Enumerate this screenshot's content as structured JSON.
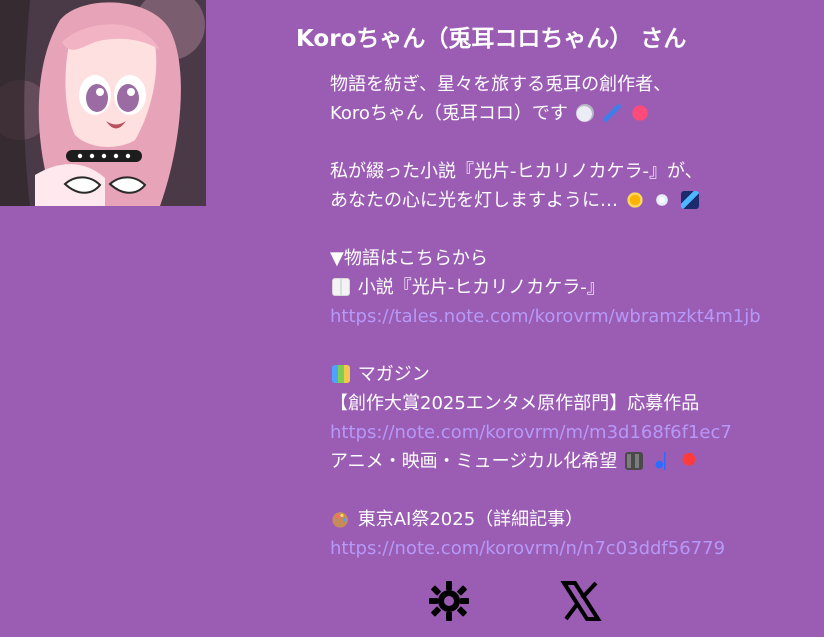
{
  "profile": {
    "title": "Koroちゃん（兎耳コロちゃん） さん",
    "avatar_icon": "anime-girl-avatar"
  },
  "bio": {
    "line1": "物語を紡ぎ、星々を旅する兎耳の創作者、",
    "line2": "Koroちゃん（兎耳コロ）です",
    "line3": "私が綴った小説『光片-ヒカリノカケラ-』が、",
    "line4": "あなたの心に光を灯しますように…",
    "section_story_heading": "▼物語はこちらから",
    "story_label": "小説『光片-ヒカリノカケラ-』",
    "story_link": "https://tales.note.com/korovrm/wbramzkt4m1jb",
    "magazine_label": "マガジン",
    "magazine_award": "【創作大賞2025エンタメ原作部門】応募作品",
    "magazine_link": "https://note.com/korovrm/m/m3d168f6f1ec7",
    "magazine_note": "アニメ・映画・ミュージカル化希望",
    "tokyo_label": "東京AI祭2025（詳細記事）",
    "tokyo_link": "https://note.com/korovrm/n/n7c03ddf56779"
  },
  "icons": {
    "rabbit": "rabbit-icon",
    "pen": "pen-icon",
    "heart": "heart-icon",
    "sun": "sun-icon",
    "snow": "snowflake-icon",
    "comet": "comet-icon",
    "book": "open-book-icon",
    "books": "books-icon",
    "film": "film-icon",
    "note": "music-note-icon",
    "dancer": "dancer-icon",
    "palette": "palette-icon",
    "settings": "gear-icon",
    "x": "x-logo-icon"
  },
  "colors": {
    "background": "#9b5db4",
    "text": "#ffffff",
    "link": "#b699f7"
  }
}
